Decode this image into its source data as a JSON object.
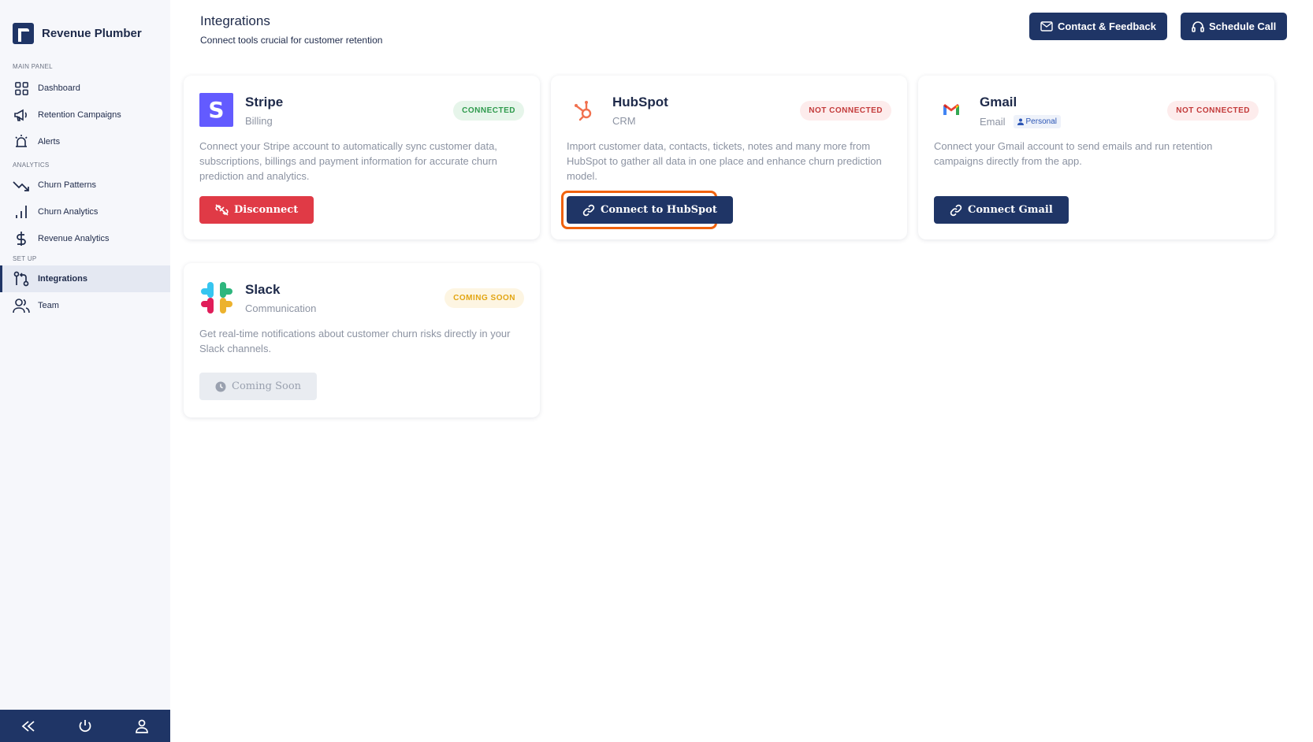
{
  "app": {
    "name": "Revenue Plumber"
  },
  "sidebar": {
    "sections": [
      {
        "label": "MAIN PANEL",
        "items": [
          {
            "label": "Dashboard",
            "icon": "grid-icon"
          },
          {
            "label": "Retention Campaigns",
            "icon": "megaphone-icon"
          },
          {
            "label": "Alerts",
            "icon": "alarm-icon"
          }
        ]
      },
      {
        "label": "ANALYTICS",
        "items": [
          {
            "label": "Churn Patterns",
            "icon": "trend-down-icon"
          },
          {
            "label": "Churn Analytics",
            "icon": "bar-chart-icon"
          },
          {
            "label": "Revenue Analytics",
            "icon": "dollar-icon"
          }
        ]
      },
      {
        "label": "SET UP",
        "items": [
          {
            "label": "Integrations",
            "icon": "git-pull-icon",
            "active": true
          },
          {
            "label": "Team",
            "icon": "users-icon"
          }
        ]
      }
    ],
    "footer": [
      "collapse-icon",
      "power-icon",
      "user-icon"
    ]
  },
  "header": {
    "title": "Integrations",
    "subtitle": "Connect tools crucial for customer retention",
    "contact_label": "Contact & Feedback",
    "schedule_label": "Schedule Call"
  },
  "integrations": [
    {
      "name": "Stripe",
      "category": "Billing",
      "status": "CONNECTED",
      "description": "Connect your Stripe account to automatically sync customer data, subscriptions, billings and payment information for accurate churn prediction and analytics.",
      "button": "Disconnect"
    },
    {
      "name": "HubSpot",
      "category": "CRM",
      "status": "NOT CONNECTED",
      "description": "Import customer data, contacts, tickets, notes and many more from HubSpot to gather all data in one place and enhance churn prediction model.",
      "button": "Connect to HubSpot"
    },
    {
      "name": "Gmail",
      "category": "Email",
      "tag": "Personal",
      "status": "NOT CONNECTED",
      "description": "Connect your Gmail account to send emails and run retention campaigns directly from the app.",
      "button": "Connect Gmail"
    },
    {
      "name": "Slack",
      "category": "Communication",
      "status": "COMING SOON",
      "description": "Get real-time notifications about customer churn risks directly in your Slack channels.",
      "button": "Coming Soon"
    }
  ],
  "colors": {
    "navy": "#1f3566",
    "danger": "#e03a46",
    "focus": "#f0620d",
    "stripe": "#635bff"
  }
}
